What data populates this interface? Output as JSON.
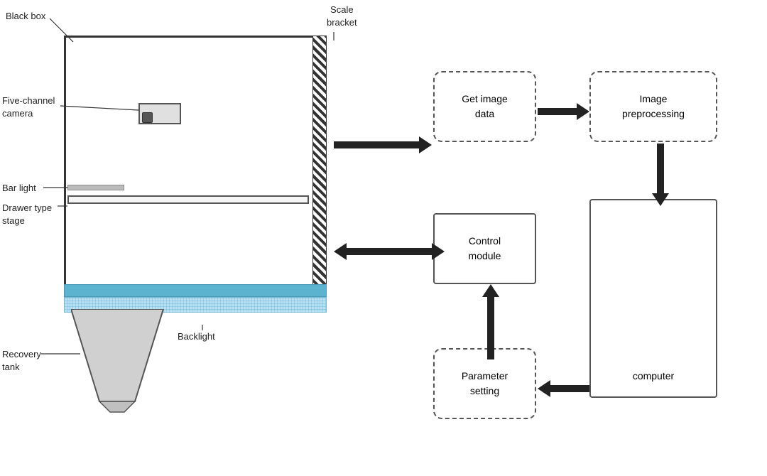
{
  "labels": {
    "black_box": "Black box",
    "scale_bracket": "Scale\nbracket",
    "five_channel_camera": "Five-channel\ncamera",
    "bar_light": "Bar light",
    "drawer_type_stage": "Drawer type\nstage",
    "recovery_tank": "Recovery\ntank",
    "backlight": "Backlight"
  },
  "flow": {
    "get_image_data": "Get image\ndata",
    "image_preprocessing": "Image\npreprocessing",
    "control_module": "Control\nmodule",
    "parameter_setting": "Parameter\nsetting",
    "computer": "computer"
  }
}
